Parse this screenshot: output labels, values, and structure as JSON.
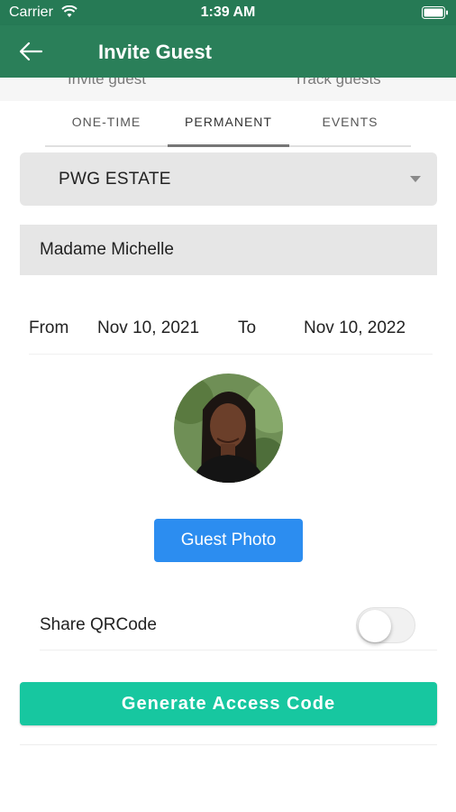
{
  "status_bar": {
    "carrier": "Carrier",
    "time": "1:39 AM"
  },
  "app_bar": {
    "title": "Invite Guest",
    "back_icon": "arrow-left-icon",
    "color": "#2a7f59"
  },
  "top_tabs": [
    "Invite guest",
    "Track guests"
  ],
  "tabs": [
    {
      "label": "ONE-TIME",
      "selected": false
    },
    {
      "label": "PERMANENT",
      "selected": true
    },
    {
      "label": "EVENTS",
      "selected": false
    }
  ],
  "estate_select": {
    "value": "PWG ESTATE"
  },
  "guest_name": {
    "value": "Madame Michelle"
  },
  "dates": {
    "from_label": "From",
    "from_value": "Nov 10, 2021",
    "to_label": "To",
    "to_value": "Nov 10, 2022"
  },
  "guest_photo_button": {
    "label": "Guest Photo",
    "color": "#2c8df0"
  },
  "share_qr": {
    "label": "Share QRCode",
    "enabled": false
  },
  "generate_button": {
    "label": "Generate Access Code",
    "color": "#17c7a0"
  }
}
